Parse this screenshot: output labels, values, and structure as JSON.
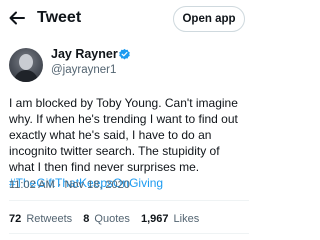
{
  "header": {
    "title": "Tweet",
    "open_app_label": "Open app"
  },
  "author": {
    "display_name": "Jay Rayner",
    "handle": "@jayrayner1",
    "verified": true
  },
  "tweet": {
    "text": "I am blocked by Toby Young. Can't imagine why. If when he's trending I want to find out exactly what he's said, I have to do an incognito twitter search. The stupidity of what I then find never surprises me.",
    "hashtag": "#TheGiftThatKeepsOnGiving",
    "time": "11:02 AM",
    "date": "Nov 18, 2020"
  },
  "stats": {
    "retweets_count": "72",
    "retweets_label": "Retweets",
    "quotes_count": "8",
    "quotes_label": "Quotes",
    "likes_count": "1,967",
    "likes_label": "Likes"
  },
  "colors": {
    "accent": "#1d9bf0",
    "secondary_text": "#536471",
    "primary_text": "#0f1419"
  },
  "icons": {
    "back": "arrow-left-icon",
    "verified": "verified-badge-icon"
  }
}
